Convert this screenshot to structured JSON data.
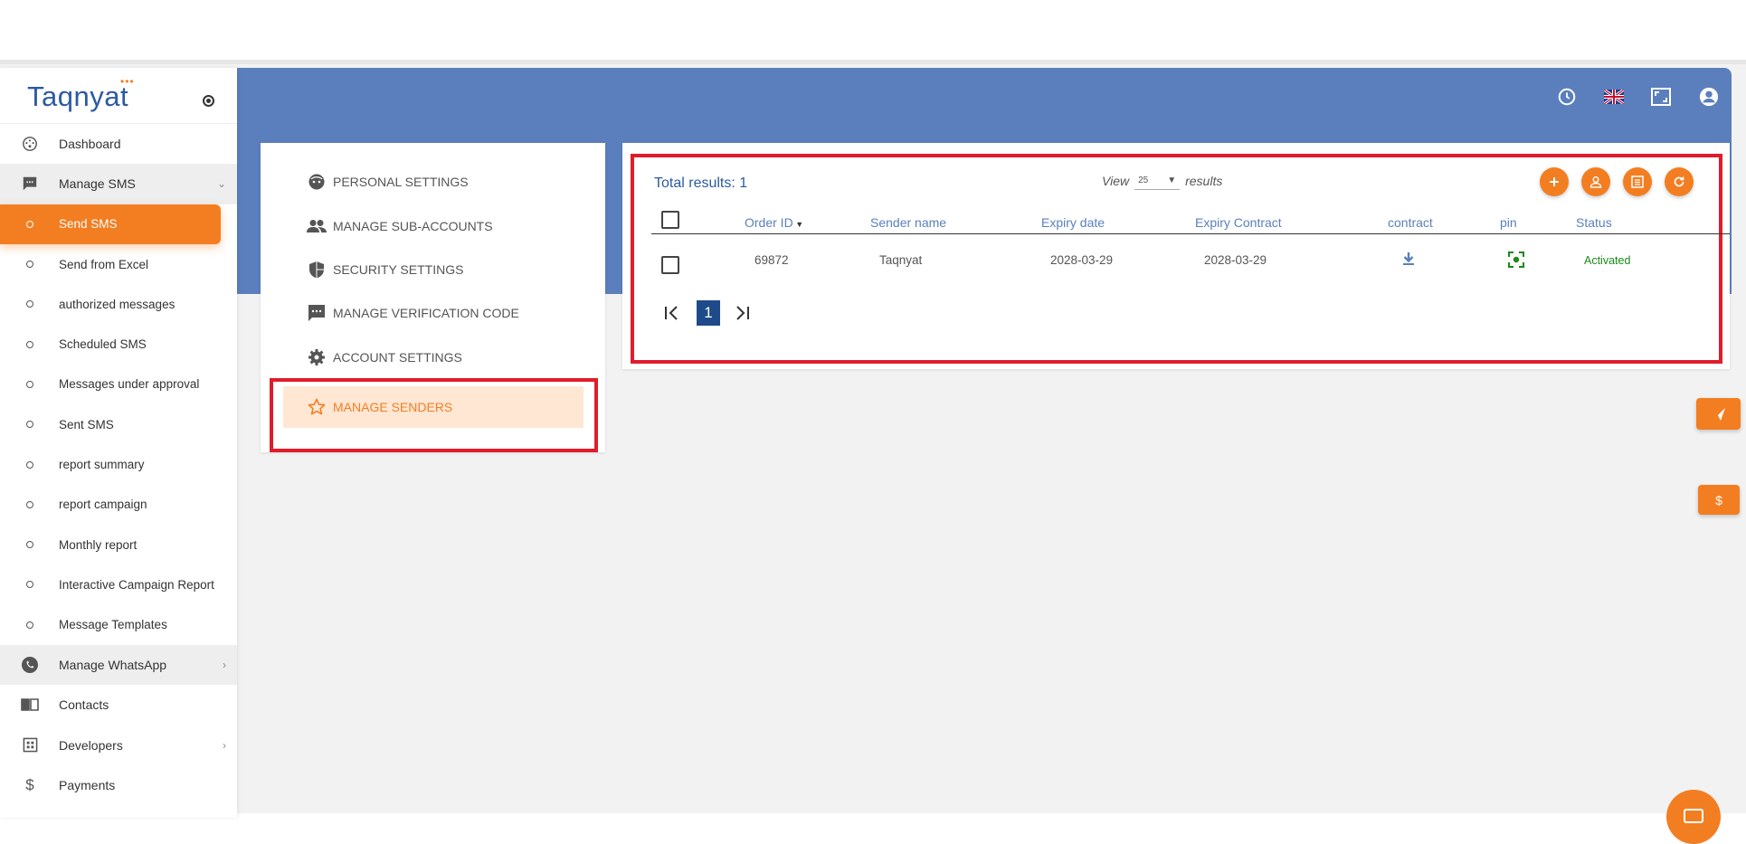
{
  "brand": {
    "name": "Taqnyat",
    "dots": "•••"
  },
  "sidebar": {
    "items": [
      {
        "label": "Dashboard",
        "icon": "dashboard-icon"
      },
      {
        "label": "Manage SMS",
        "icon": "sms-icon"
      },
      {
        "label": "Send SMS"
      },
      {
        "label": "Send from Excel"
      },
      {
        "label": "authorized messages"
      },
      {
        "label": "Scheduled SMS"
      },
      {
        "label": "Messages under approval"
      },
      {
        "label": "Sent SMS"
      },
      {
        "label": "report summary"
      },
      {
        "label": "report campaign"
      },
      {
        "label": "Monthly report"
      },
      {
        "label": "Interactive Campaign Report"
      },
      {
        "label": "Message Templates"
      },
      {
        "label": "Manage WhatsApp",
        "icon": "whatsapp-icon"
      },
      {
        "label": "Contacts",
        "icon": "contacts-icon"
      },
      {
        "label": "Developers",
        "icon": "developers-icon"
      },
      {
        "label": "Payments",
        "icon": "dollar-icon"
      }
    ]
  },
  "settings_menu": {
    "items": [
      {
        "label": "PERSONAL SETTINGS",
        "icon": "face-icon"
      },
      {
        "label": "MANAGE SUB-ACCOUNTS",
        "icon": "people-icon"
      },
      {
        "label": "SECURITY SETTINGS",
        "icon": "shield-icon"
      },
      {
        "label": "MANAGE VERIFICATION CODE",
        "icon": "message-dots-icon"
      },
      {
        "label": "ACCOUNT SETTINGS",
        "icon": "gear-icon"
      },
      {
        "label": "MANAGE SENDERS",
        "icon": "star-icon"
      }
    ]
  },
  "table": {
    "total_label": "Total results: 1",
    "view_label": "View",
    "view_value": "25",
    "results_label": "results",
    "columns": [
      "Order ID",
      "Sender name",
      "Expiry date",
      "Expiry Contract",
      "contract",
      "pin",
      "Status"
    ],
    "rows": [
      {
        "order_id": "69872",
        "sender_name": "Taqnyat",
        "expiry_date": "2028-03-29",
        "expiry_contract": "2028-03-29",
        "status": "Activated"
      }
    ],
    "page": "1"
  },
  "colors": {
    "accent": "#f37e22",
    "header": "#5b7fbd",
    "brand_blue": "#2c5aa0",
    "status_green": "#1a8a1a",
    "highlight_red": "#e01c2b"
  },
  "floating": {
    "dollar": "$"
  }
}
